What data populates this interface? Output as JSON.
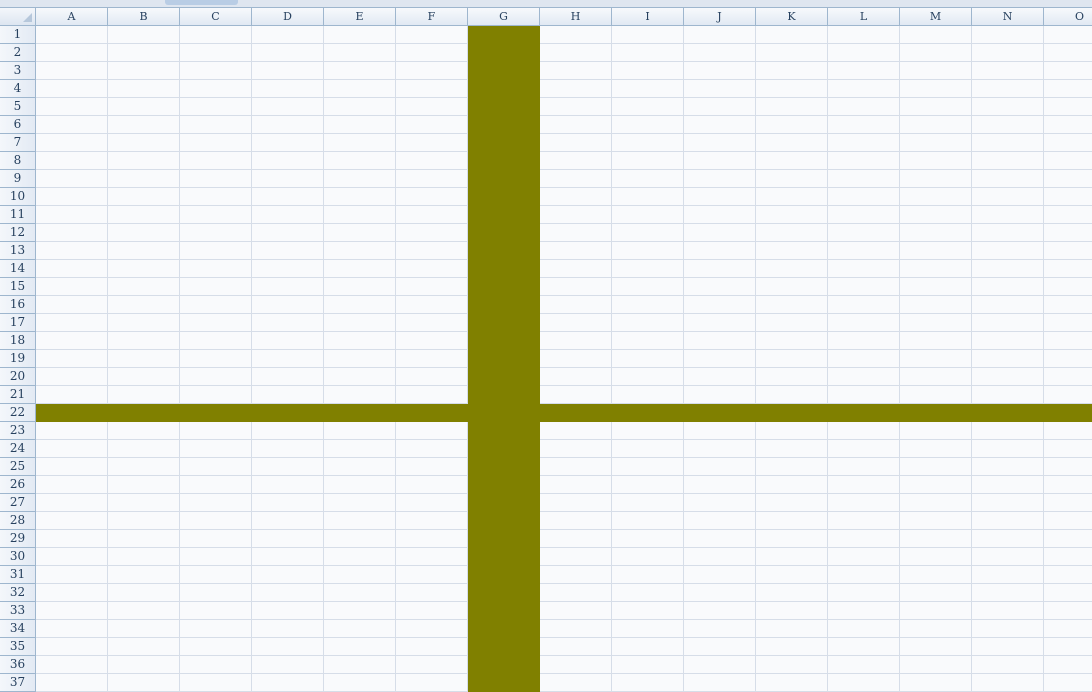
{
  "columns": [
    "A",
    "B",
    "C",
    "D",
    "E",
    "F",
    "G",
    "H",
    "I",
    "J",
    "K",
    "L",
    "M",
    "N",
    "O"
  ],
  "rows": [
    "1",
    "2",
    "3",
    "4",
    "5",
    "6",
    "7",
    "8",
    "9",
    "10",
    "11",
    "12",
    "13",
    "14",
    "15",
    "16",
    "17",
    "18",
    "19",
    "20",
    "21",
    "22",
    "23",
    "24",
    "25",
    "26",
    "27",
    "28",
    "29",
    "30",
    "31",
    "32",
    "33",
    "34",
    "35",
    "36",
    "37"
  ],
  "highlight": {
    "row": "22",
    "column": "G",
    "color": "#808000"
  },
  "colors": {
    "grid_line": "#d6dde8",
    "header_border": "#9eb6ce",
    "header_text": "#27415f"
  }
}
